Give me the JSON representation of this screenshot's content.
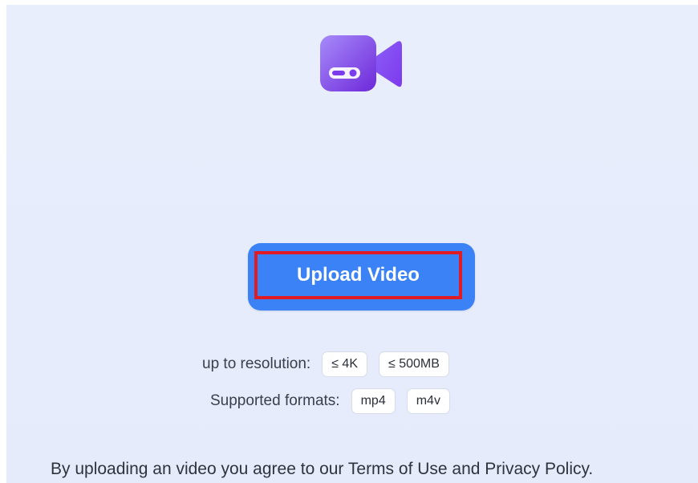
{
  "icon": {
    "name": "video-camera-icon"
  },
  "upload": {
    "label": "Upload Video"
  },
  "limits": {
    "label": "up to resolution:",
    "resolution": "≤ 4K",
    "size": "≤ 500MB"
  },
  "formats": {
    "label": "Supported formats:",
    "items": [
      "mp4",
      "m4v"
    ]
  },
  "footer": {
    "text": "By uploading an video you agree to our Terms of Use and Privacy Policy."
  },
  "colors": {
    "panel_bg": "#e8edfc",
    "button_bg": "#3b82f6",
    "highlight_border": "#e01b24",
    "icon_gradient_start": "#8b7cf6",
    "icon_gradient_end": "#6d3ff5"
  }
}
